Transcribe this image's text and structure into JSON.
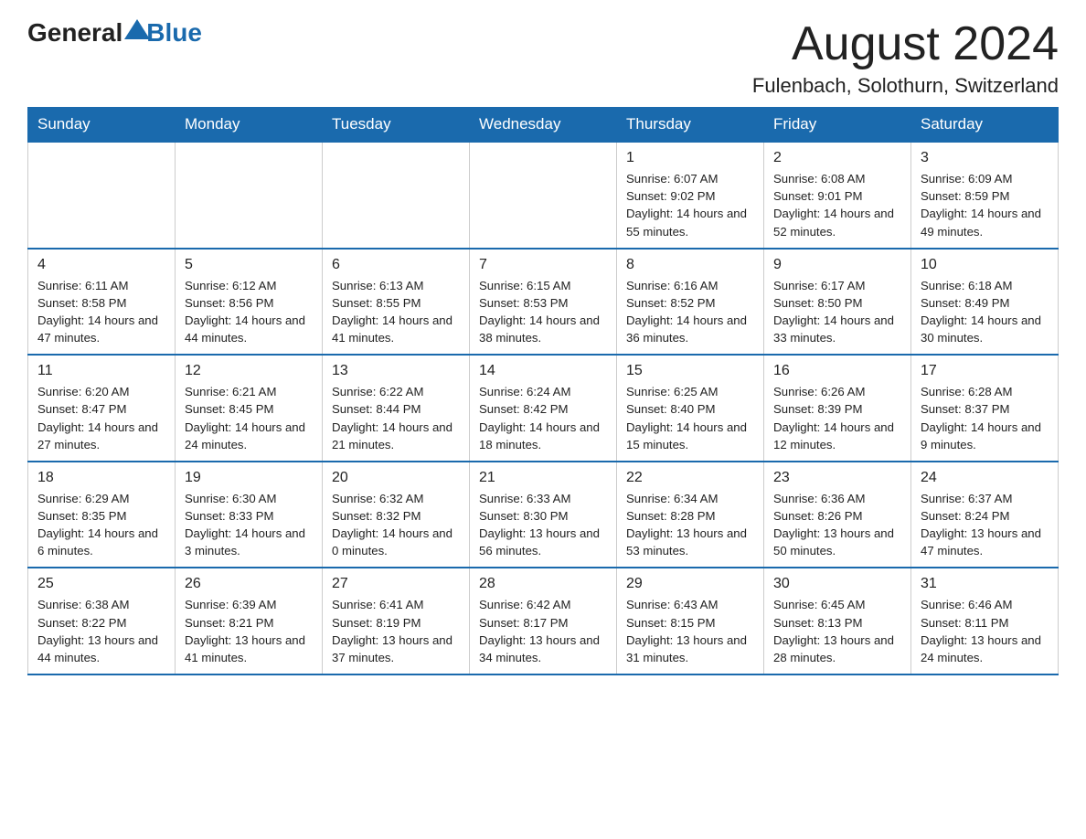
{
  "header": {
    "logo_general": "General",
    "logo_blue": "Blue",
    "month_title": "August 2024",
    "location": "Fulenbach, Solothurn, Switzerland"
  },
  "days_of_week": [
    "Sunday",
    "Monday",
    "Tuesday",
    "Wednesday",
    "Thursday",
    "Friday",
    "Saturday"
  ],
  "weeks": [
    [
      {
        "day": "",
        "info": ""
      },
      {
        "day": "",
        "info": ""
      },
      {
        "day": "",
        "info": ""
      },
      {
        "day": "",
        "info": ""
      },
      {
        "day": "1",
        "info": "Sunrise: 6:07 AM\nSunset: 9:02 PM\nDaylight: 14 hours and 55 minutes."
      },
      {
        "day": "2",
        "info": "Sunrise: 6:08 AM\nSunset: 9:01 PM\nDaylight: 14 hours and 52 minutes."
      },
      {
        "day": "3",
        "info": "Sunrise: 6:09 AM\nSunset: 8:59 PM\nDaylight: 14 hours and 49 minutes."
      }
    ],
    [
      {
        "day": "4",
        "info": "Sunrise: 6:11 AM\nSunset: 8:58 PM\nDaylight: 14 hours and 47 minutes."
      },
      {
        "day": "5",
        "info": "Sunrise: 6:12 AM\nSunset: 8:56 PM\nDaylight: 14 hours and 44 minutes."
      },
      {
        "day": "6",
        "info": "Sunrise: 6:13 AM\nSunset: 8:55 PM\nDaylight: 14 hours and 41 minutes."
      },
      {
        "day": "7",
        "info": "Sunrise: 6:15 AM\nSunset: 8:53 PM\nDaylight: 14 hours and 38 minutes."
      },
      {
        "day": "8",
        "info": "Sunrise: 6:16 AM\nSunset: 8:52 PM\nDaylight: 14 hours and 36 minutes."
      },
      {
        "day": "9",
        "info": "Sunrise: 6:17 AM\nSunset: 8:50 PM\nDaylight: 14 hours and 33 minutes."
      },
      {
        "day": "10",
        "info": "Sunrise: 6:18 AM\nSunset: 8:49 PM\nDaylight: 14 hours and 30 minutes."
      }
    ],
    [
      {
        "day": "11",
        "info": "Sunrise: 6:20 AM\nSunset: 8:47 PM\nDaylight: 14 hours and 27 minutes."
      },
      {
        "day": "12",
        "info": "Sunrise: 6:21 AM\nSunset: 8:45 PM\nDaylight: 14 hours and 24 minutes."
      },
      {
        "day": "13",
        "info": "Sunrise: 6:22 AM\nSunset: 8:44 PM\nDaylight: 14 hours and 21 minutes."
      },
      {
        "day": "14",
        "info": "Sunrise: 6:24 AM\nSunset: 8:42 PM\nDaylight: 14 hours and 18 minutes."
      },
      {
        "day": "15",
        "info": "Sunrise: 6:25 AM\nSunset: 8:40 PM\nDaylight: 14 hours and 15 minutes."
      },
      {
        "day": "16",
        "info": "Sunrise: 6:26 AM\nSunset: 8:39 PM\nDaylight: 14 hours and 12 minutes."
      },
      {
        "day": "17",
        "info": "Sunrise: 6:28 AM\nSunset: 8:37 PM\nDaylight: 14 hours and 9 minutes."
      }
    ],
    [
      {
        "day": "18",
        "info": "Sunrise: 6:29 AM\nSunset: 8:35 PM\nDaylight: 14 hours and 6 minutes."
      },
      {
        "day": "19",
        "info": "Sunrise: 6:30 AM\nSunset: 8:33 PM\nDaylight: 14 hours and 3 minutes."
      },
      {
        "day": "20",
        "info": "Sunrise: 6:32 AM\nSunset: 8:32 PM\nDaylight: 14 hours and 0 minutes."
      },
      {
        "day": "21",
        "info": "Sunrise: 6:33 AM\nSunset: 8:30 PM\nDaylight: 13 hours and 56 minutes."
      },
      {
        "day": "22",
        "info": "Sunrise: 6:34 AM\nSunset: 8:28 PM\nDaylight: 13 hours and 53 minutes."
      },
      {
        "day": "23",
        "info": "Sunrise: 6:36 AM\nSunset: 8:26 PM\nDaylight: 13 hours and 50 minutes."
      },
      {
        "day": "24",
        "info": "Sunrise: 6:37 AM\nSunset: 8:24 PM\nDaylight: 13 hours and 47 minutes."
      }
    ],
    [
      {
        "day": "25",
        "info": "Sunrise: 6:38 AM\nSunset: 8:22 PM\nDaylight: 13 hours and 44 minutes."
      },
      {
        "day": "26",
        "info": "Sunrise: 6:39 AM\nSunset: 8:21 PM\nDaylight: 13 hours and 41 minutes."
      },
      {
        "day": "27",
        "info": "Sunrise: 6:41 AM\nSunset: 8:19 PM\nDaylight: 13 hours and 37 minutes."
      },
      {
        "day": "28",
        "info": "Sunrise: 6:42 AM\nSunset: 8:17 PM\nDaylight: 13 hours and 34 minutes."
      },
      {
        "day": "29",
        "info": "Sunrise: 6:43 AM\nSunset: 8:15 PM\nDaylight: 13 hours and 31 minutes."
      },
      {
        "day": "30",
        "info": "Sunrise: 6:45 AM\nSunset: 8:13 PM\nDaylight: 13 hours and 28 minutes."
      },
      {
        "day": "31",
        "info": "Sunrise: 6:46 AM\nSunset: 8:11 PM\nDaylight: 13 hours and 24 minutes."
      }
    ]
  ]
}
